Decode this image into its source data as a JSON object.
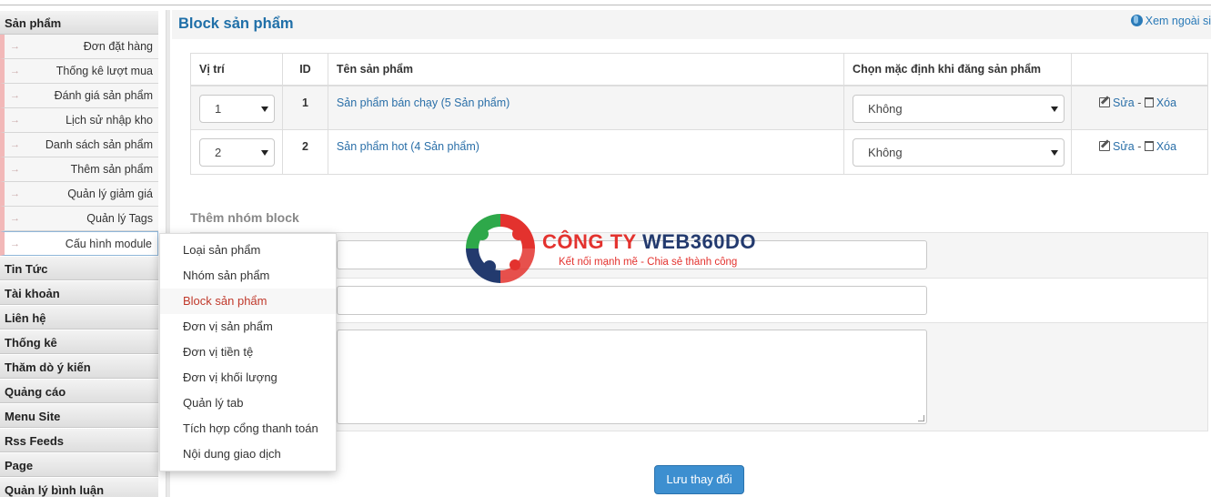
{
  "sidebar": {
    "sections": [
      {
        "label": "Sản phẩm",
        "items": [
          "Đơn đặt hàng",
          "Thống kê lượt mua",
          "Đánh giá sản phẩm",
          "Lịch sử nhập kho",
          "Danh sách sản phẩm",
          "Thêm sản phẩm",
          "Quản lý giảm giá",
          "Quản lý Tags",
          "Cấu hình module"
        ]
      },
      {
        "label": "Tin Tức"
      },
      {
        "label": "Tài khoản"
      },
      {
        "label": "Liên hệ"
      },
      {
        "label": "Thống kê"
      },
      {
        "label": "Thăm dò ý kiến"
      },
      {
        "label": "Quảng cáo"
      },
      {
        "label": "Menu Site"
      },
      {
        "label": "Rss Feeds"
      },
      {
        "label": "Page"
      },
      {
        "label": "Quản lý bình luận"
      }
    ],
    "arrow_glyph": "→"
  },
  "header": {
    "title": "Block sản phẩm",
    "view_out": "Xem ngoài si"
  },
  "table": {
    "headers": [
      "Vị trí",
      "ID",
      "Tên sản phẩm",
      "Chọn mặc định khi đăng sản phẩm",
      ""
    ],
    "rows": [
      {
        "position": "1",
        "id": "1",
        "name": "Sản phẩm bán chạy (5 Sản phẩm)",
        "default": "Không",
        "edit": "Sửa",
        "sep": "-",
        "delete": "Xóa"
      },
      {
        "position": "2",
        "id": "2",
        "name": "Sản phẩm hot (4 Sản phẩm)",
        "default": "Không",
        "edit": "Sửa",
        "sep": "-",
        "delete": "Xóa"
      }
    ]
  },
  "form": {
    "title": "Thêm nhóm block",
    "save_label": "Lưu thay đổi"
  },
  "menu": {
    "items": [
      "Loại sản phẩm",
      "Nhóm sản phẩm",
      "Block sản phẩm",
      "Đơn vị sản phẩm",
      "Đơn vị tiền tệ",
      "Đơn vị khối lượng",
      "Quản lý tab",
      "Tích hợp cổng thanh toán",
      "Nội dung giao dịch"
    ],
    "active_index": 2
  },
  "logo": {
    "title_a": "CÔNG TY ",
    "title_b": "WEB360DO",
    "tagline": "Kết nối mạnh mẽ - Chia sẻ thành công"
  },
  "colors": {
    "accent": "#1f6fa8",
    "link": "#2a6fa8",
    "button": "#3d8fd0",
    "menu_active": "#c0392b",
    "logo_red": "#e3322e",
    "logo_navy": "#233a6e",
    "logo_green": "#2ea84a"
  }
}
